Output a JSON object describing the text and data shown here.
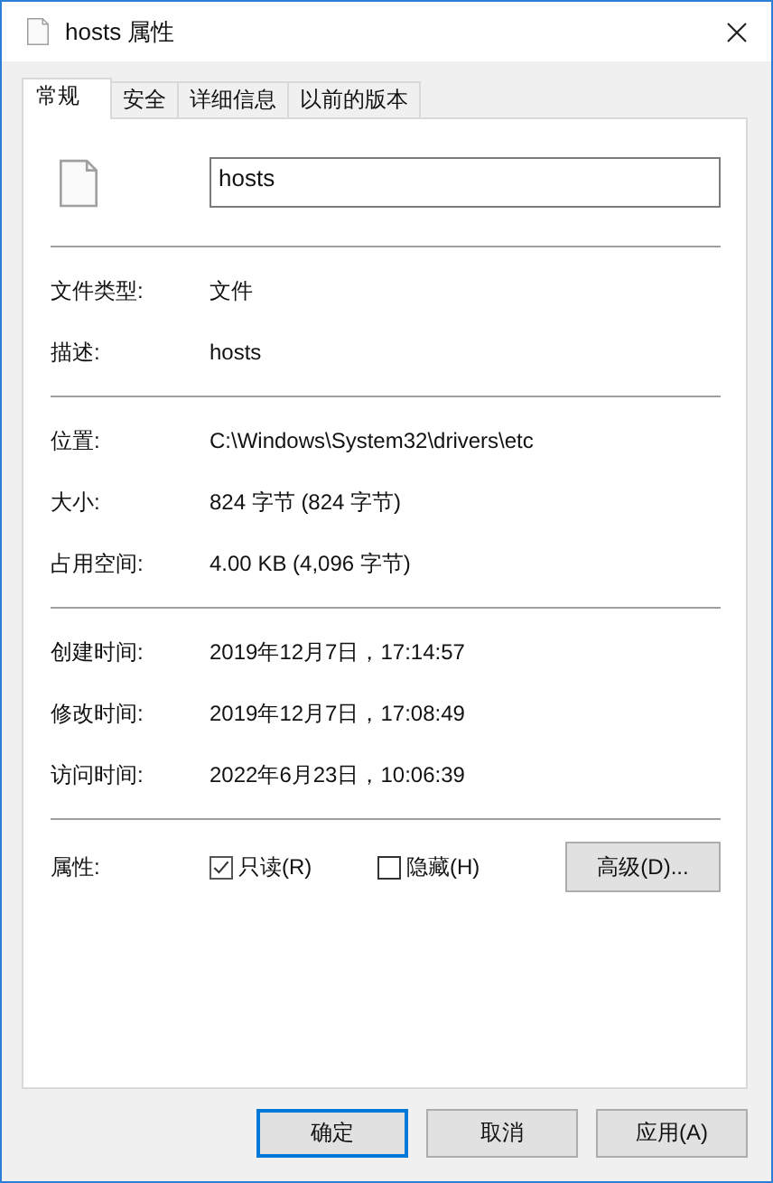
{
  "window": {
    "title": "hosts 属性"
  },
  "tabs": [
    {
      "label": "常规",
      "selected": true
    },
    {
      "label": "安全",
      "selected": false
    },
    {
      "label": "详细信息",
      "selected": false
    },
    {
      "label": "以前的版本",
      "selected": false
    }
  ],
  "name_field": {
    "value": "hosts"
  },
  "sections": [
    [
      {
        "label": "文件类型:",
        "value": "文件"
      },
      {
        "label": "描述:",
        "value": "hosts"
      }
    ],
    [
      {
        "label": "位置:",
        "value": "C:\\Windows\\System32\\drivers\\etc"
      },
      {
        "label": "大小:",
        "value": "824 字节 (824 字节)"
      },
      {
        "label": "占用空间:",
        "value": "4.00 KB (4,096 字节)"
      }
    ],
    [
      {
        "label": "创建时间:",
        "value": "2019年12月7日，17:14:57"
      },
      {
        "label": "修改时间:",
        "value": "2019年12月7日，17:08:49"
      },
      {
        "label": "访问时间:",
        "value": "2022年6月23日，10:06:39"
      }
    ]
  ],
  "attributes": {
    "label": "属性:",
    "checkboxes": [
      {
        "label": "只读(R)",
        "checked": true
      },
      {
        "label": "隐藏(H)",
        "checked": false
      }
    ],
    "button": "高级(D)..."
  },
  "buttons": [
    {
      "label": "确定",
      "default": true
    },
    {
      "label": "取消",
      "default": false
    },
    {
      "label": "应用(A)",
      "default": false
    }
  ]
}
